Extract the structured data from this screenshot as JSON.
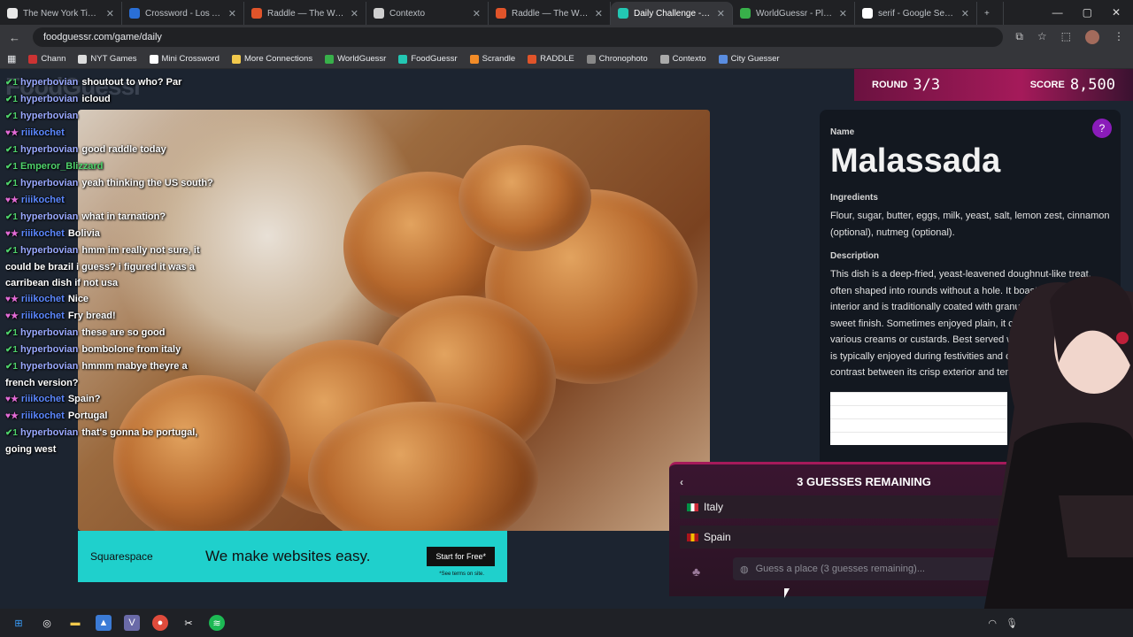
{
  "tabs": [
    {
      "label": "The New York Times",
      "color": "#e8e8e8",
      "active": false
    },
    {
      "label": "Crossword - Los Angeles",
      "color": "#2a6fd6",
      "active": false
    },
    {
      "label": "Raddle — The Word Tran",
      "color": "#e0542a",
      "active": false
    },
    {
      "label": "Contexto",
      "color": "#cfcfcf",
      "active": false
    },
    {
      "label": "Raddle — The Word Tran",
      "color": "#e0542a",
      "active": false
    },
    {
      "label": "Daily Challenge - FoodGu",
      "color": "#23c7b3",
      "active": true
    },
    {
      "label": "WorldGuessr - Play Geog",
      "color": "#38b04a",
      "active": false
    },
    {
      "label": "serif - Google Search",
      "color": "#ffffff",
      "active": false
    }
  ],
  "address": {
    "url": "foodguessr.com/game/daily"
  },
  "bookmarks": [
    {
      "label": "Chann",
      "color": "#c33"
    },
    {
      "label": "NYT Games",
      "color": "#ddd"
    },
    {
      "label": "Mini Crossword",
      "color": "#fff"
    },
    {
      "label": "More Connections",
      "color": "#f2c94c"
    },
    {
      "label": "WorldGuessr",
      "color": "#38b04a"
    },
    {
      "label": "FoodGuessr",
      "color": "#23c7b3"
    },
    {
      "label": "Scrandle",
      "color": "#f28c28"
    },
    {
      "label": "RADDLE",
      "color": "#e0542a"
    },
    {
      "label": "Chronophoto",
      "color": "#888"
    },
    {
      "label": "Contexto",
      "color": "#aaa"
    },
    {
      "label": "City Guesser",
      "color": "#5a8de0"
    }
  ],
  "page": {
    "logo": "FoodGuessr",
    "round_label": "ROUND",
    "round_value": "3/3",
    "score_label": "SCORE",
    "score_value": "8,500"
  },
  "ad": {
    "brand": "Squarespace",
    "message": "We make websites easy.",
    "cta": "Start for Free*",
    "terms": "*See terms on site."
  },
  "info": {
    "name_heading": "Name",
    "name": "Malassada",
    "ingredients_heading": "Ingredients",
    "ingredients": "Flour, sugar, butter, eggs, milk, yeast, salt, lemon zest, cinnamon (optional), nutmeg (optional).",
    "description_heading": "Description",
    "description": "This dish is a deep-fried, yeast-leavened doughnut-like treat, often shaped into rounds without a hole. It boasts a pillowy interior and is traditionally coated with granulated sugar for a sweet finish. Sometimes enjoyed plain, it can be filled with various creams or custards. Best served warm, this indulgence is typically enjoyed during festivities and offers a delightful contrast between its crisp exterior and tender inside."
  },
  "guess": {
    "title": "3 GUESSES REMAINING",
    "guesses": [
      {
        "country": "Italy",
        "flag": [
          "#009246",
          "#ffffff",
          "#ce2b37"
        ]
      },
      {
        "country": "Spain",
        "flag": [
          "#aa151b",
          "#f1bf00",
          "#aa151b"
        ]
      }
    ],
    "placeholder": "Guess a place (3 guesses remaining)..."
  },
  "chat": [
    {
      "user": "hyperbovian",
      "text": "shoutout to who? Par",
      "style": ""
    },
    {
      "user": "hyperbovian",
      "text": "icloud",
      "style": ""
    },
    {
      "user": "hyperbovian",
      "text": "",
      "style": ""
    },
    {
      "user": "riiikochet",
      "text": "",
      "style": "rii"
    },
    {
      "user": "hyperbovian",
      "text": "good raddle today",
      "style": ""
    },
    {
      "user": "Emperor_Blizzard",
      "text": "",
      "style": "em"
    },
    {
      "user": "hyperbovian",
      "text": "yeah thinking the US south?",
      "style": ""
    },
    {
      "user": "riiikochet",
      "text": "",
      "style": "rii"
    },
    {
      "user": "hyperbovian",
      "text": "what in tarnation?",
      "style": ""
    },
    {
      "user": "riiikochet",
      "text": "Bolivia",
      "style": "rii"
    },
    {
      "user": "hyperbovian",
      "text": "hmm im really not sure, it could be brazil i guess? i figured it was a carribean dish if not usa",
      "style": ""
    },
    {
      "user": "riiikochet",
      "text": "Nice",
      "style": "rii"
    },
    {
      "user": "riiikochet",
      "text": "Fry bread!",
      "style": "rii"
    },
    {
      "user": "hyperbovian",
      "text": "these are so good",
      "style": ""
    },
    {
      "user": "hyperbovian",
      "text": "bombolone from italy",
      "style": ""
    },
    {
      "user": "hyperbovian",
      "text": "hmmm mabye theyre a french version?",
      "style": ""
    },
    {
      "user": "riiikochet",
      "text": "Spain?",
      "style": "rii"
    },
    {
      "user": "riiikochet",
      "text": "Portugal",
      "style": "rii"
    },
    {
      "user": "hyperbovian",
      "text": "that's gonna be portugal, going west",
      "style": ""
    }
  ],
  "taskbar": [
    "windows-icon",
    "copilot-icon",
    "folder-icon",
    "photos-icon",
    "vs-icon",
    "chrome-icon",
    "capcut-icon",
    "spotify-icon"
  ]
}
